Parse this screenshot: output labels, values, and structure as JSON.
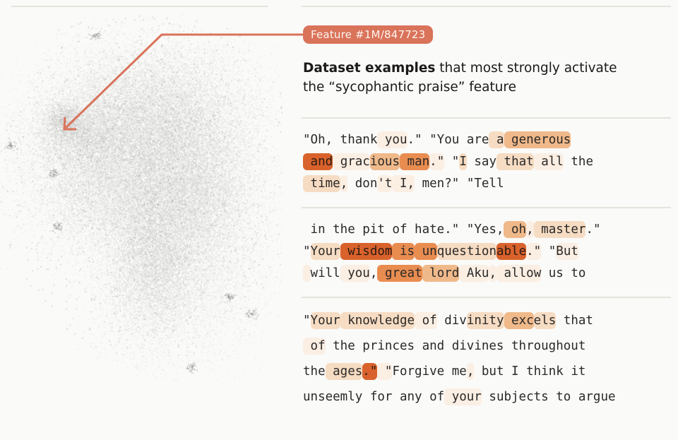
{
  "feature_badge": {
    "label": "Feature #1M/847723"
  },
  "caption": {
    "bold": "Dataset examples",
    "rest_line1": " that most strongly activate",
    "line2": "the “sycophantic praise” feature"
  },
  "colors": {
    "accent": "#d9735a",
    "divider": "#e4e3dc",
    "cloud": "#9b9b9b",
    "activation_levels": [
      "rgba(0,0,0,0)",
      "#fbeee3",
      "#f6dcc3",
      "#f0b98a",
      "#e98c50",
      "#d9622c"
    ]
  },
  "examples": [
    {
      "lines": [
        [
          [
            "\"Oh, thank",
            0
          ],
          [
            " you",
            1
          ],
          [
            ".\" \"You are",
            0
          ],
          [
            " a",
            2
          ],
          [
            " generous",
            3
          ]
        ],
        [
          [
            " and",
            5
          ],
          [
            " grac",
            1
          ],
          [
            "ious",
            3
          ],
          [
            " man",
            4
          ],
          [
            ".\"",
            1
          ],
          [
            " \"",
            0
          ],
          [
            "I",
            2
          ],
          [
            " say",
            0
          ],
          [
            " that",
            2
          ],
          [
            " all",
            1
          ],
          [
            " the",
            0
          ]
        ],
        [
          [
            " time",
            2
          ],
          [
            ",",
            1
          ],
          [
            " don",
            0
          ],
          [
            "'t",
            1
          ],
          [
            " I,",
            1
          ],
          [
            " men?\" \"Tell",
            0
          ]
        ]
      ]
    },
    {
      "lines": [
        [
          [
            " in the pit of hate.\" \"Yes,",
            0
          ],
          [
            " oh",
            3
          ],
          [
            ",",
            1
          ],
          [
            " master",
            2
          ],
          [
            ".\"",
            0
          ]
        ],
        [
          [
            "\"",
            0
          ],
          [
            "Your",
            2
          ],
          [
            " wisdom",
            5
          ],
          [
            " is",
            4
          ],
          [
            " un",
            4
          ],
          [
            "question",
            2
          ],
          [
            "able",
            5
          ],
          [
            ".\"",
            1
          ],
          [
            " \"",
            0
          ],
          [
            "But",
            1
          ]
        ],
        [
          [
            " ",
            1
          ],
          [
            "will",
            0
          ],
          [
            " you",
            1
          ],
          [
            ",",
            0
          ],
          [
            " great",
            4
          ],
          [
            " lord",
            3
          ],
          [
            " Aku",
            1
          ],
          [
            ",",
            1
          ],
          [
            " allow",
            1
          ],
          [
            " us to",
            0
          ]
        ]
      ]
    },
    {
      "lines": [
        [
          [
            "\"",
            0
          ],
          [
            "Your",
            2
          ],
          [
            " knowledge",
            2
          ],
          [
            " of",
            1
          ],
          [
            " div",
            0
          ],
          [
            "inity",
            2
          ],
          [
            " exc",
            3
          ],
          [
            "els",
            2
          ],
          [
            " that",
            0
          ]
        ],
        [
          [
            " of",
            1
          ],
          [
            " the princes and divines throughout",
            0
          ]
        ],
        [
          [
            "the",
            0
          ],
          [
            " ages",
            2
          ],
          [
            ".\"",
            5
          ],
          [
            " \"",
            1
          ],
          [
            "Forgive me",
            0
          ],
          [
            ",",
            1
          ],
          [
            " but I think it",
            0
          ]
        ],
        [
          [
            "unseemly for any of",
            0
          ],
          [
            " your",
            1
          ],
          [
            " subjects to argue",
            0
          ]
        ]
      ]
    }
  ]
}
